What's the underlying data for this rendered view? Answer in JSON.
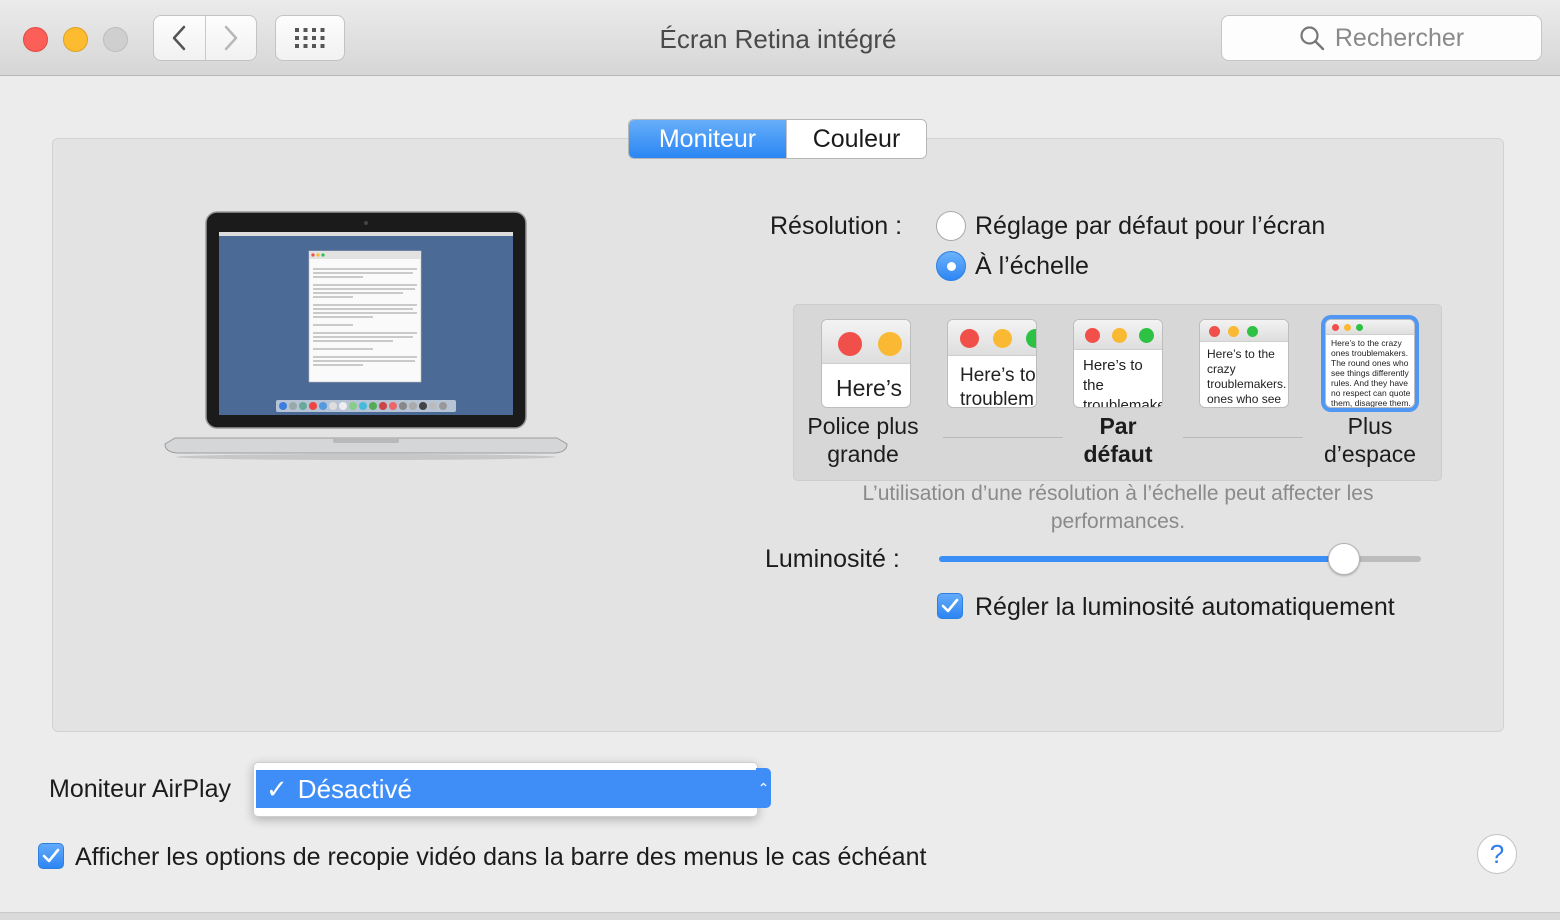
{
  "window": {
    "title": "Écran Retina intégré"
  },
  "search": {
    "placeholder": "Rechercher"
  },
  "tabs": [
    {
      "label": "Moniteur",
      "selected": true
    },
    {
      "label": "Couleur",
      "selected": false
    }
  ],
  "resolution": {
    "label": "Résolution :",
    "options": [
      {
        "label": "Réglage par défaut pour l’écran",
        "selected": false
      },
      {
        "label": "À l’échelle",
        "selected": true
      }
    ],
    "scales": [
      {
        "label_lines": [
          "Police plus",
          "grande"
        ],
        "sample_text": "Here’s"
      },
      {
        "sample_text": "Here’s to troublem"
      },
      {
        "label_lines": [
          "Par",
          "défaut"
        ],
        "sample_text": "Here’s to the troublemakers, ones who"
      },
      {
        "sample_text": "Here’s to the crazy troublemakers. ones who see things rules. And they"
      },
      {
        "label_lines": [
          "Plus",
          "d’espace"
        ],
        "selected": true,
        "sample_text": "Here’s to the crazy ones troublemakers. The round ones who see things differently rules. And they have no respect can quote them, disagree them. About the only thing Because they change things"
      }
    ],
    "note": "L’utilisation d’une résolution à l’échelle peut affecter les performances."
  },
  "brightness": {
    "label": "Luminosité :",
    "value": 0.84,
    "auto_label": "Régler la luminosité automatiquement",
    "auto_checked": true
  },
  "airplay": {
    "label": "Moniteur AirPlay",
    "selected": "Désactivé",
    "check_glyph": "✓"
  },
  "mirroring": {
    "label": "Afficher les options de recopie vidéo dans la barre des menus le cas échéant",
    "checked": true
  },
  "help": {
    "glyph": "?"
  },
  "colors": {
    "accent": "#3a8ef6",
    "close": "#fc5f57",
    "minimize": "#fdbc2f"
  }
}
